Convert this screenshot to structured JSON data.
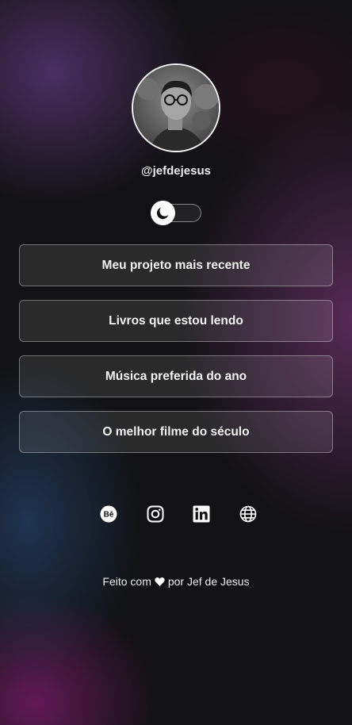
{
  "profile": {
    "username": "@jefdejesus",
    "avatar_icon": "profile-photo"
  },
  "theme_toggle": {
    "icon": "moon-icon",
    "state": "dark"
  },
  "links": [
    {
      "label": "Meu projeto mais recente"
    },
    {
      "label": "Livros que estou lendo"
    },
    {
      "label": "Música preferida do ano"
    },
    {
      "label": "O melhor filme do século"
    }
  ],
  "socials": [
    {
      "icon": "behance-icon"
    },
    {
      "icon": "instagram-icon"
    },
    {
      "icon": "linkedin-icon"
    },
    {
      "icon": "globe-icon"
    }
  ],
  "footer": {
    "prefix": "Feito com",
    "suffix": "por Jef de Jesus",
    "icon": "heart-icon"
  },
  "colors": {
    "background": "#121214",
    "text": "#f2f2f4",
    "accent_purple": "#8c3c8c",
    "accent_magenta": "#961e82",
    "accent_blue": "#285082"
  }
}
